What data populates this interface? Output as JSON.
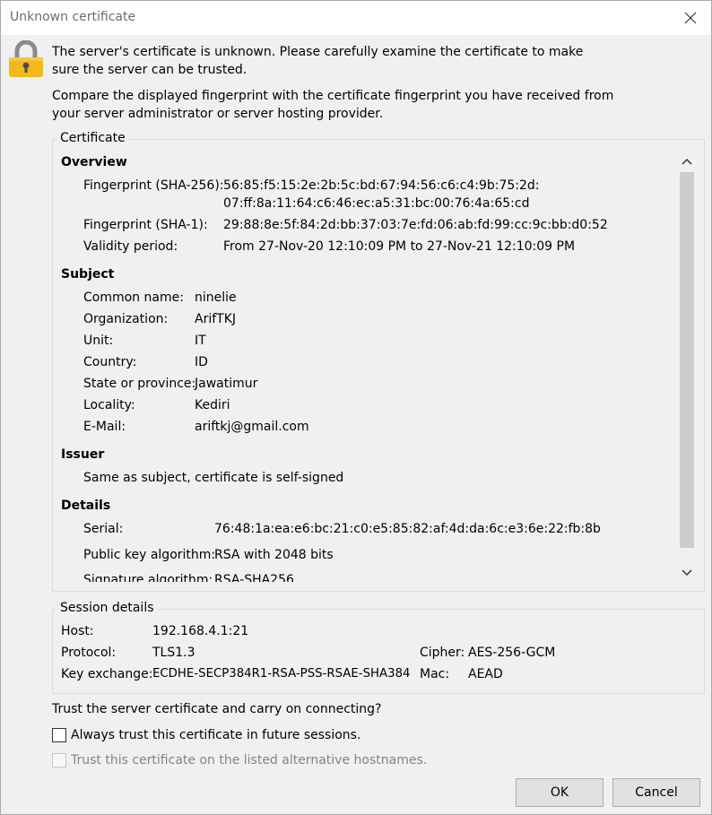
{
  "window": {
    "title": "Unknown certificate"
  },
  "icons": {
    "lock": "padlock-icon",
    "close": "close-icon",
    "scroll_up": "chevron-up-icon",
    "scroll_down": "chevron-down-icon"
  },
  "message": {
    "line1": "The server's certificate is unknown. Please carefully examine the certificate to make sure the server can be trusted.",
    "line2": "Compare the displayed fingerprint with the certificate fingerprint you have received from your server administrator or server hosting provider."
  },
  "certificate": {
    "legend": "Certificate",
    "overview": {
      "heading": "Overview",
      "sha256_label": "Fingerprint (SHA-256):",
      "sha256_value_1": "56:85:f5:15:2e:2b:5c:bd:67:94:56:c6:c4:9b:75:2d:",
      "sha256_value_2": "07:ff:8a:11:64:c6:46:ec:a5:31:bc:00:76:4a:65:cd",
      "sha1_label": "Fingerprint (SHA-1):",
      "sha1_value": "29:88:8e:5f:84:2d:bb:37:03:7e:fd:06:ab:fd:99:cc:9c:bb:d0:52",
      "validity_label": "Validity period:",
      "validity_value": "From 27-Nov-20 12:10:09 PM to 27-Nov-21 12:10:09 PM"
    },
    "subject": {
      "heading": "Subject",
      "rows": [
        {
          "label": "Common name:",
          "value": "ninelie"
        },
        {
          "label": "Organization:",
          "value": "ArifTKJ"
        },
        {
          "label": "Unit:",
          "value": "IT"
        },
        {
          "label": "Country:",
          "value": "ID"
        },
        {
          "label": "State or province:",
          "value": "Jawatimur"
        },
        {
          "label": "Locality:",
          "value": "Kediri"
        },
        {
          "label": "E-Mail:",
          "value": "ariftkj@gmail.com"
        }
      ]
    },
    "issuer": {
      "heading": "Issuer",
      "text": "Same as subject, certificate is self-signed"
    },
    "details": {
      "heading": "Details",
      "serial_label": "Serial:",
      "serial_value": "76:48:1a:ea:e6:bc:21:c0:e5:85:82:af:4d:da:6c:e3:6e:22:fb:8b",
      "pubkey_label": "Public key algorithm:",
      "pubkey_value": "RSA with 2048 bits",
      "sig_label": "Signature algorithm:",
      "sig_value": "RSA-SHA256"
    },
    "scroll_position": 0.0
  },
  "session": {
    "legend": "Session details",
    "host_label": "Host:",
    "host_value": "192.168.4.1:21",
    "protocol_label": "Protocol:",
    "protocol_value": "TLS1.3",
    "cipher_label": "Cipher:",
    "cipher_value": "AES-256-GCM",
    "kex_label": "Key exchange:",
    "kex_value": "ECDHE-SECP384R1-RSA-PSS-RSAE-SHA384",
    "mac_label": "Mac:",
    "mac_value": "AEAD"
  },
  "trust": {
    "question": "Trust the server certificate and carry on connecting?",
    "always_label": "Always trust this certificate in future sessions.",
    "always_checked": false,
    "alt_hosts_label": "Trust this certificate on the listed alternative hostnames.",
    "alt_hosts_checked": false,
    "alt_hosts_enabled": false
  },
  "buttons": {
    "ok": "OK",
    "cancel": "Cancel"
  },
  "colors": {
    "lock_body": "#f2b91c",
    "lock_shackle": "#8a8a8a",
    "disabled_text": "#838383"
  }
}
